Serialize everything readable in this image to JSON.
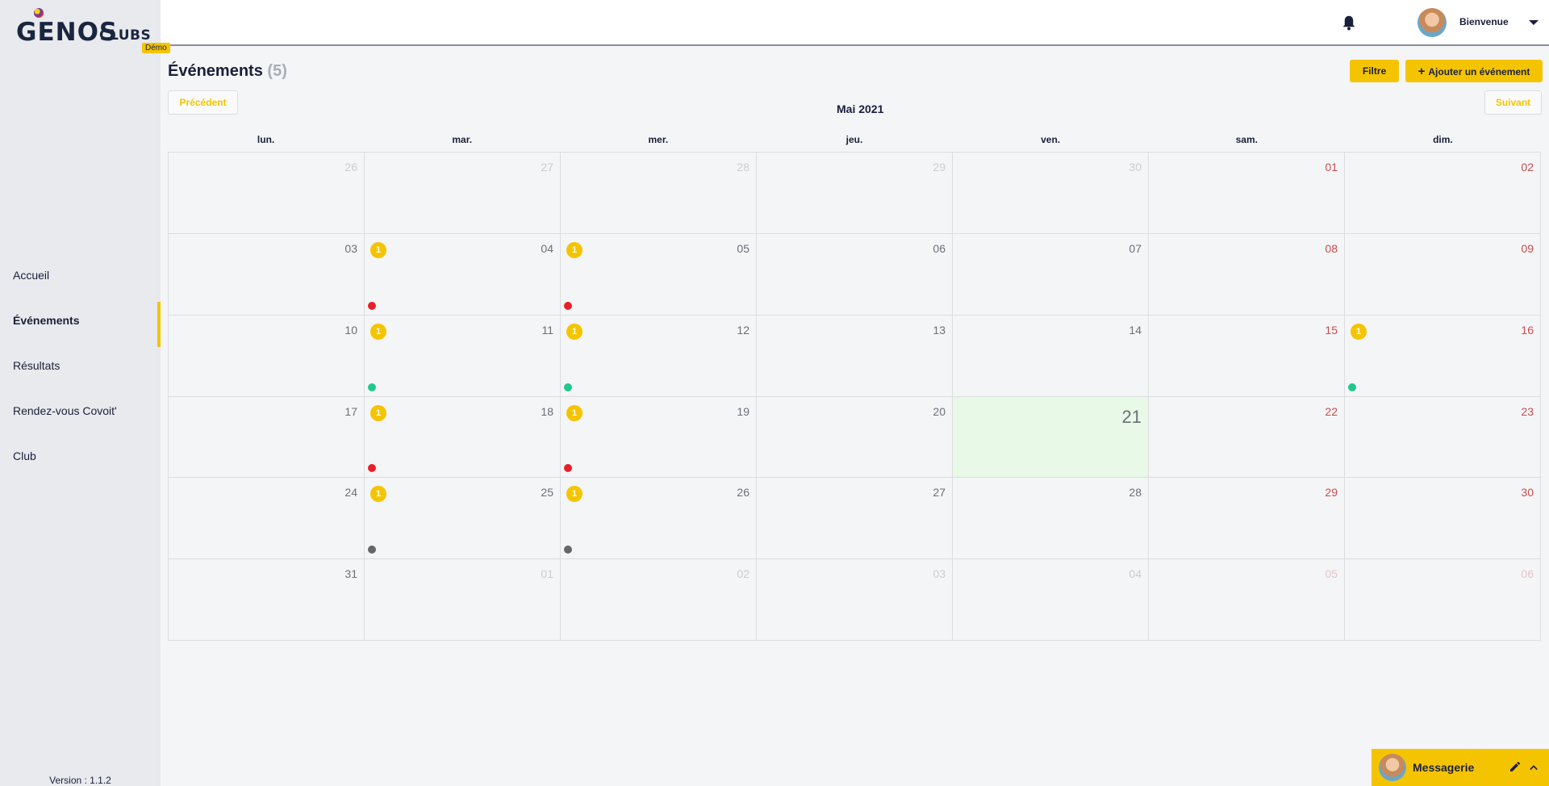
{
  "app": {
    "logo_main": "GENOS",
    "logo_sub": "CLUBS",
    "demo_badge": "Démo",
    "version": "Version : 1.1.2"
  },
  "sidebar": {
    "items": [
      {
        "label": "Accueil",
        "name": "sidebar-item-accueil",
        "active": false
      },
      {
        "label": "Événements",
        "name": "sidebar-item-evenements",
        "active": true
      },
      {
        "label": "Résultats",
        "name": "sidebar-item-resultats",
        "active": false
      },
      {
        "label": "Rendez-vous Covoit'",
        "name": "sidebar-item-covoit",
        "active": false
      },
      {
        "label": "Club",
        "name": "sidebar-item-club",
        "active": false
      }
    ]
  },
  "topbar": {
    "welcome": "Bienvenue",
    "icons": {
      "bell": "bell-icon",
      "caret": "caret-down-icon"
    }
  },
  "header": {
    "title": "Événements",
    "count": "(5)",
    "filter_label": "Filtre",
    "add_label": "Ajouter un événement",
    "prev_label": "Précédent",
    "next_label": "Suivant",
    "month": "Mai 2021"
  },
  "calendar": {
    "weekdays": [
      "lun.",
      "mar.",
      "mer.",
      "jeu.",
      "ven.",
      "sam.",
      "dim."
    ],
    "weeks": [
      [
        {
          "d": "26",
          "other": true
        },
        {
          "d": "27",
          "other": true
        },
        {
          "d": "28",
          "other": true
        },
        {
          "d": "29",
          "other": true
        },
        {
          "d": "30",
          "other": true
        },
        {
          "d": "01"
        },
        {
          "d": "02"
        }
      ],
      [
        {
          "d": "03"
        },
        {
          "d": "04",
          "badge": "1",
          "dot": "#e8202a"
        },
        {
          "d": "05",
          "badge": "1",
          "dot": "#e8202a"
        },
        {
          "d": "06"
        },
        {
          "d": "07"
        },
        {
          "d": "08"
        },
        {
          "d": "09"
        }
      ],
      [
        {
          "d": "10"
        },
        {
          "d": "11",
          "badge": "1",
          "dot": "#1fc98a"
        },
        {
          "d": "12",
          "badge": "1",
          "dot": "#1fc98a"
        },
        {
          "d": "13"
        },
        {
          "d": "14"
        },
        {
          "d": "15"
        },
        {
          "d": "16",
          "badge": "1",
          "dot": "#1fc98a"
        }
      ],
      [
        {
          "d": "17"
        },
        {
          "d": "18",
          "badge": "1",
          "dot": "#e8202a"
        },
        {
          "d": "19",
          "badge": "1",
          "dot": "#e8202a"
        },
        {
          "d": "20"
        },
        {
          "d": "21",
          "today": true
        },
        {
          "d": "22"
        },
        {
          "d": "23"
        }
      ],
      [
        {
          "d": "24"
        },
        {
          "d": "25",
          "badge": "1",
          "dot": "#666666"
        },
        {
          "d": "26",
          "badge": "1",
          "dot": "#666666"
        },
        {
          "d": "27"
        },
        {
          "d": "28"
        },
        {
          "d": "29"
        },
        {
          "d": "30"
        }
      ],
      [
        {
          "d": "31"
        },
        {
          "d": "01",
          "other": true
        },
        {
          "d": "02",
          "other": true
        },
        {
          "d": "03",
          "other": true
        },
        {
          "d": "04",
          "other": true
        },
        {
          "d": "05",
          "other": true
        },
        {
          "d": "06",
          "other": true
        }
      ]
    ]
  },
  "messaging": {
    "label": "Messagerie",
    "icons": {
      "edit": "pencil-icon",
      "collapse": "chevron-up-icon"
    }
  },
  "colors": {
    "accent": "#f5c400",
    "sidebar_bg": "#e9eaed",
    "today_bg": "#e8f9e8",
    "weekend_text": "#c94c4c"
  }
}
